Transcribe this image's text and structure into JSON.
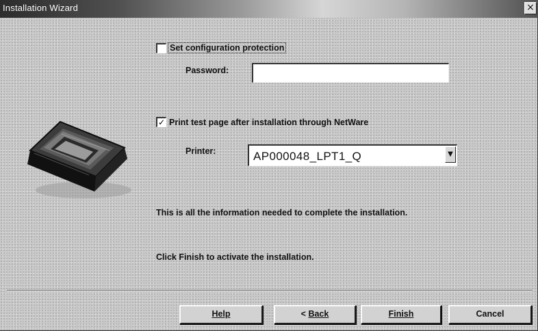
{
  "window": {
    "title": "Installation Wizard",
    "close_glyph": "×"
  },
  "protection": {
    "label": "Set configuration protection",
    "checked": false,
    "check_glyph": ""
  },
  "password": {
    "label": "Password:",
    "value": ""
  },
  "print_test": {
    "label": "Print test page after installation through NetWare",
    "checked": true,
    "check_glyph": "✓"
  },
  "printer": {
    "label": "Printer:",
    "selected": "AP000048_LPT1_Q",
    "dropdown_glyph": "▼"
  },
  "info": {
    "line1": "This is all the information needed to complete the installation.",
    "line2": "Click Finish to activate the installation."
  },
  "buttons": {
    "help": "Help",
    "back_prefix": "< ",
    "back": "Back",
    "finish": "Finish",
    "cancel": "Cancel"
  },
  "illustration": {
    "icon": "printer-server-box-icon"
  }
}
